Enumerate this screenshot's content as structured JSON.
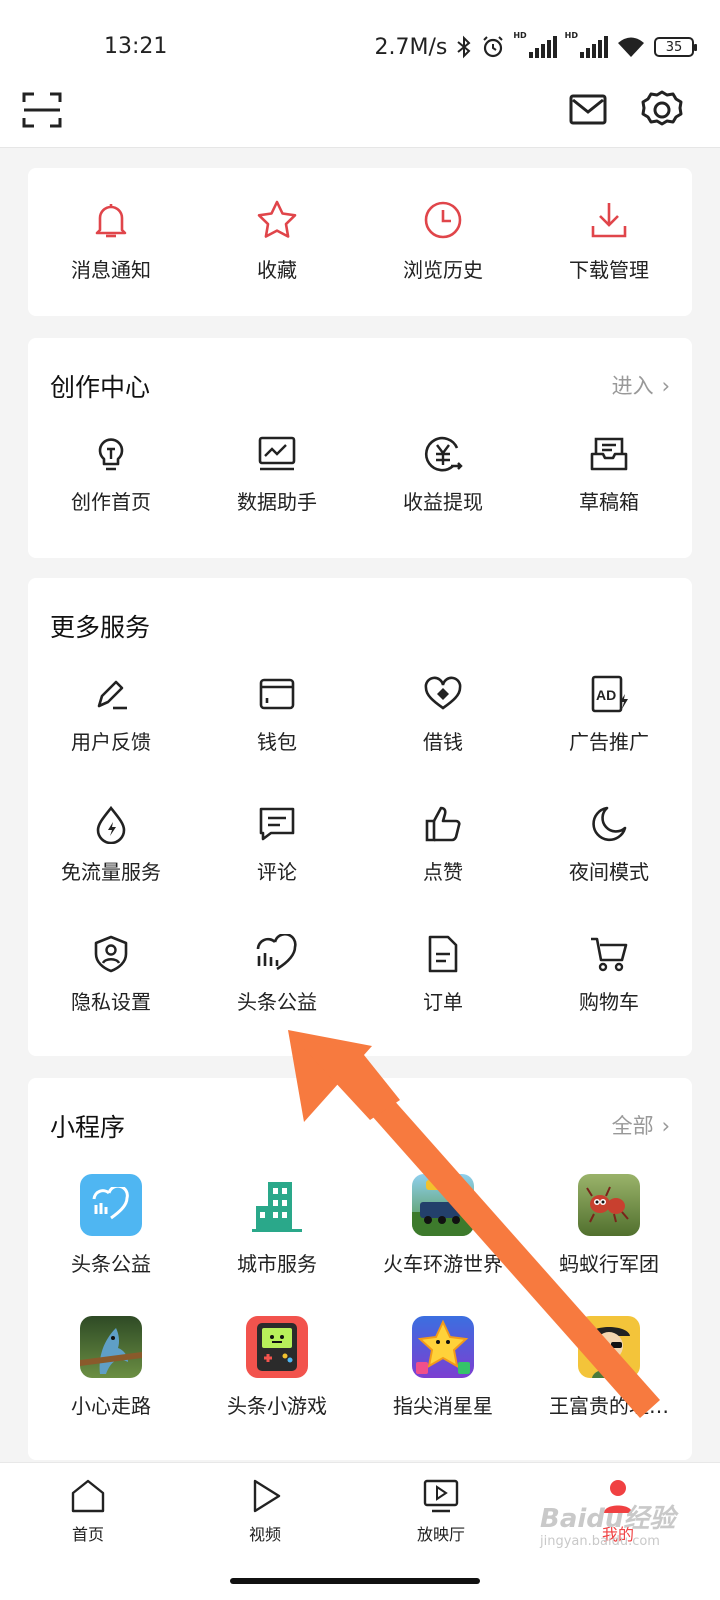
{
  "status_bar": {
    "time": "13:21",
    "net_speed": "2.7M/s",
    "hd1": "HD",
    "hd2": "HD",
    "battery": "35",
    "icons": [
      "bluetooth-icon",
      "alarm-icon",
      "signal-icon",
      "signal-icon",
      "wifi-icon",
      "battery-icon"
    ]
  },
  "top_bar": {
    "icons": [
      "scan-icon",
      "mail-icon",
      "settings-icon"
    ]
  },
  "quick_actions": [
    {
      "label": "消息通知",
      "icon": "bell-icon"
    },
    {
      "label": "收藏",
      "icon": "star-icon"
    },
    {
      "label": "浏览历史",
      "icon": "clock-icon"
    },
    {
      "label": "下载管理",
      "icon": "download-icon"
    }
  ],
  "creation_center": {
    "title": "创作中心",
    "link": "进入",
    "items": [
      {
        "label": "创作首页",
        "icon": "lightbulb-icon"
      },
      {
        "label": "数据助手",
        "icon": "chart-monitor-icon"
      },
      {
        "label": "收益提现",
        "icon": "yuan-withdraw-icon"
      },
      {
        "label": "草稿箱",
        "icon": "draft-box-icon"
      }
    ]
  },
  "more_services": {
    "title": "更多服务",
    "items": [
      {
        "label": "用户反馈",
        "icon": "edit-pen-icon"
      },
      {
        "label": "钱包",
        "icon": "wallet-icon"
      },
      {
        "label": "借钱",
        "icon": "loan-icon"
      },
      {
        "label": "广告推广",
        "icon": "ad-icon"
      },
      {
        "label": "免流量服务",
        "icon": "data-drop-icon"
      },
      {
        "label": "评论",
        "icon": "comment-icon"
      },
      {
        "label": "点赞",
        "icon": "thumbs-up-icon"
      },
      {
        "label": "夜间模式",
        "icon": "moon-icon"
      },
      {
        "label": "隐私设置",
        "icon": "privacy-shield-icon"
      },
      {
        "label": "头条公益",
        "icon": "charity-heart-icon"
      },
      {
        "label": "订单",
        "icon": "order-doc-icon"
      },
      {
        "label": "购物车",
        "icon": "cart-icon"
      }
    ]
  },
  "mini_programs": {
    "title": "小程序",
    "link": "全部",
    "items": [
      {
        "label": "头条公益",
        "icon": "charity-app-icon",
        "color": "#4fb6f2"
      },
      {
        "label": "城市服务",
        "icon": "city-building-icon",
        "color": "#2aa88a"
      },
      {
        "label": "火车环游世界",
        "icon": "train-game-icon",
        "color": "#4f8f3a"
      },
      {
        "label": "蚂蚁行军团",
        "icon": "ant-game-icon",
        "color": "#6a8f3f"
      },
      {
        "label": "小心走路",
        "icon": "shark-game-icon",
        "color": "#3c5a2e"
      },
      {
        "label": "头条小游戏",
        "icon": "gamepad-app-icon",
        "color": "#f2534d"
      },
      {
        "label": "指尖消星星",
        "icon": "star-game-icon",
        "color": "#3b6fe0"
      },
      {
        "label": "王富贵的垃…",
        "icon": "character-game-icon",
        "color": "#f3c43a"
      }
    ]
  },
  "bottom_nav": [
    {
      "label": "首页",
      "icon": "home-icon",
      "active": false
    },
    {
      "label": "视频",
      "icon": "play-icon",
      "active": false
    },
    {
      "label": "放映厅",
      "icon": "tv-play-icon",
      "active": false
    },
    {
      "label": "我的",
      "icon": "profile-icon",
      "active": true
    }
  ],
  "watermark": "Baidu经验",
  "watermark_sub": "jingyan.baidu.com",
  "colors": {
    "accent_red": "#f04142",
    "arrow": "#f77a3f"
  }
}
